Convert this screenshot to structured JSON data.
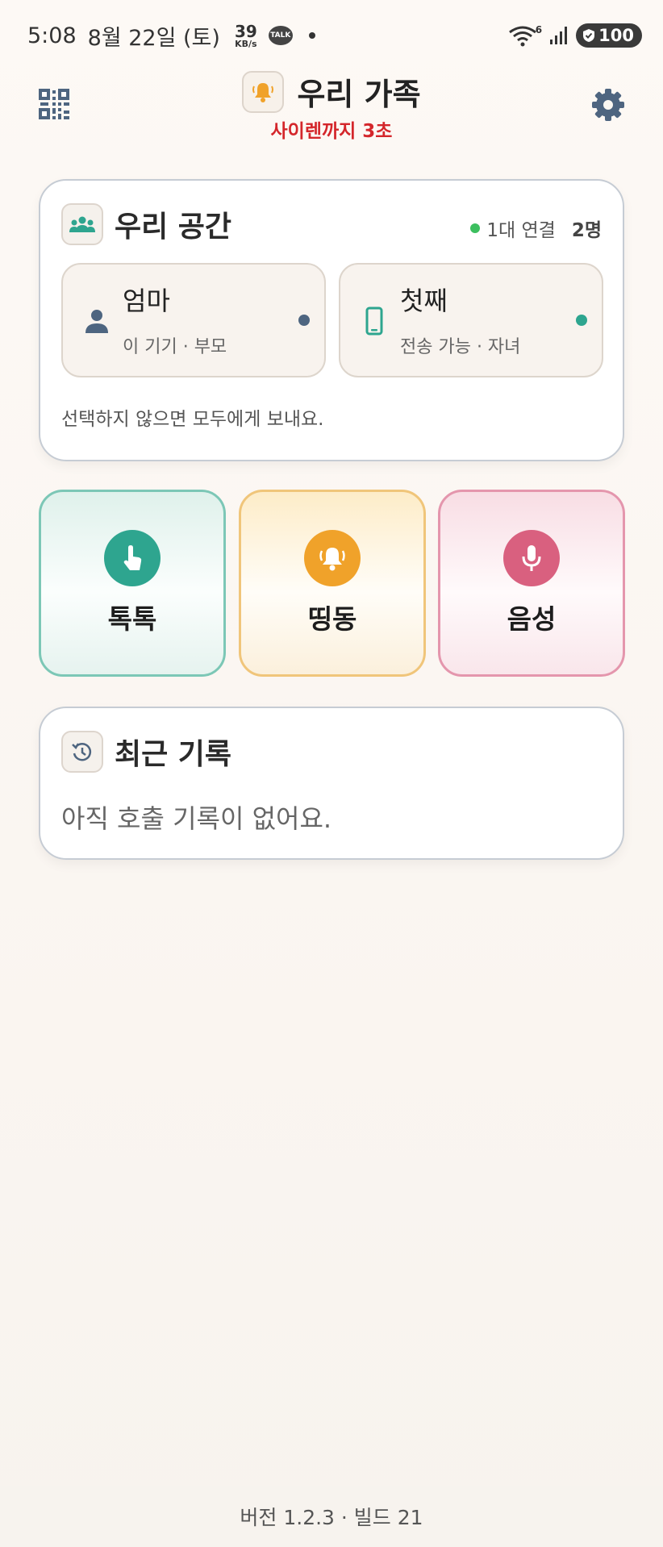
{
  "status_bar": {
    "time": "5:08",
    "date": "8월 22일 (토)",
    "speed_value": "39",
    "speed_unit": "KB/s",
    "talk_badge": "TALK",
    "network_label": "6",
    "battery": "100"
  },
  "header": {
    "title": "우리 가족",
    "siren_countdown": "사이렌까지 3초",
    "icons": {
      "left": "qr-code-icon",
      "center": "bell-icon",
      "right": "gear-icon"
    }
  },
  "space": {
    "title": "우리 공간",
    "connection": "1대 연결",
    "member_count": "2명",
    "members": [
      {
        "name": "엄마",
        "detail": "이 기기 · 부모",
        "icon": "person-icon",
        "status_color": "#4e6580"
      },
      {
        "name": "첫째",
        "detail": "전송 가능 · 자녀",
        "icon": "phone-icon",
        "status_color": "#2ea58f"
      }
    ],
    "hint": "선택하지 않으면 모두에게 보내요."
  },
  "actions": [
    {
      "label": "톡톡",
      "icon": "tap-hand-icon",
      "color": "#2ea58f"
    },
    {
      "label": "띵동",
      "icon": "bell-ring-icon",
      "color": "#f0a22a"
    },
    {
      "label": "음성",
      "icon": "microphone-icon",
      "color": "#d9607f"
    }
  ],
  "recent": {
    "title": "최근 기록",
    "empty": "아직 호출 기록이 없어요."
  },
  "footer": {
    "version": "버전 1.2.3 · 빌드 21"
  }
}
